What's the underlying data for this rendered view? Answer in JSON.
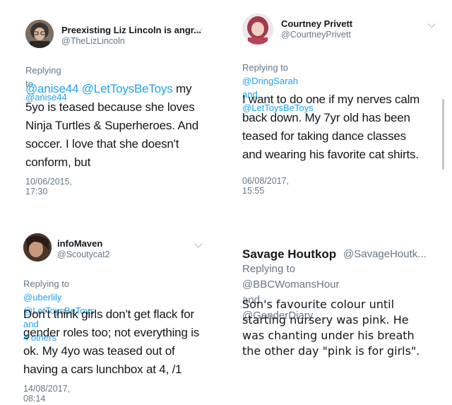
{
  "tweets": [
    {
      "name": "Preexisting Liz Lincoln is angr...",
      "handle": "@TheLizLincoln",
      "reply_prefix": "Replying to",
      "reply_to": "@anise44",
      "body_link": "@anise44 @LetToysBeToys",
      "body_lines": [
        " my",
        "5yo is teased because she loves",
        "Ninja Turtles & Superheroes. And",
        "soccer. I love that she doesn't",
        "conform, but"
      ],
      "date": "10/06/2015, 17:30"
    },
    {
      "name": "Courtney Privett",
      "handle": "@CourtneyPrivett",
      "reply_prefix": "Replying to",
      "reply_to_line1": "@DringSarah and",
      "reply_to_line2": "@LetToysBeToys",
      "body_lines": [
        "I want to do one if my nerves calm",
        "back down. My 7yr old has been",
        "teased for taking dance classes",
        "and wearing his favorite cat shirts."
      ],
      "date": "06/08/2017, 15:55"
    },
    {
      "name": "infoMaven",
      "handle": "@Scoutycat2",
      "reply_prefix": "Replying to",
      "reply_to_line1": "@uberlily @LetToysBeToys and",
      "reply_to_line2": "4 others",
      "body_lines": [
        "Don't think girls don't get flack for",
        "gender roles too; not everything is",
        "ok. My 4yo was teased out of",
        "having a cars lunchbox at 4, /1"
      ],
      "date": "14/08/2017, 08:14"
    },
    {
      "name": "Savage Houtkop",
      "handle": "@SavageHoutk...",
      "reply_prefix": "Replying to",
      "reply_to_line1": "@BBCWomansHour and",
      "reply_to_line2": "@GenderDiary",
      "body_lines": [
        "Son's favourite colour until",
        "starting nursery was pink. He",
        "was chanting under his breath",
        "the other day \"pink is for girls\"."
      ]
    }
  ],
  "icons": {
    "more": "chevron-down-icon"
  },
  "colors": {
    "link": "#1da1f2",
    "muted": "#657786",
    "text": "#14171a"
  }
}
